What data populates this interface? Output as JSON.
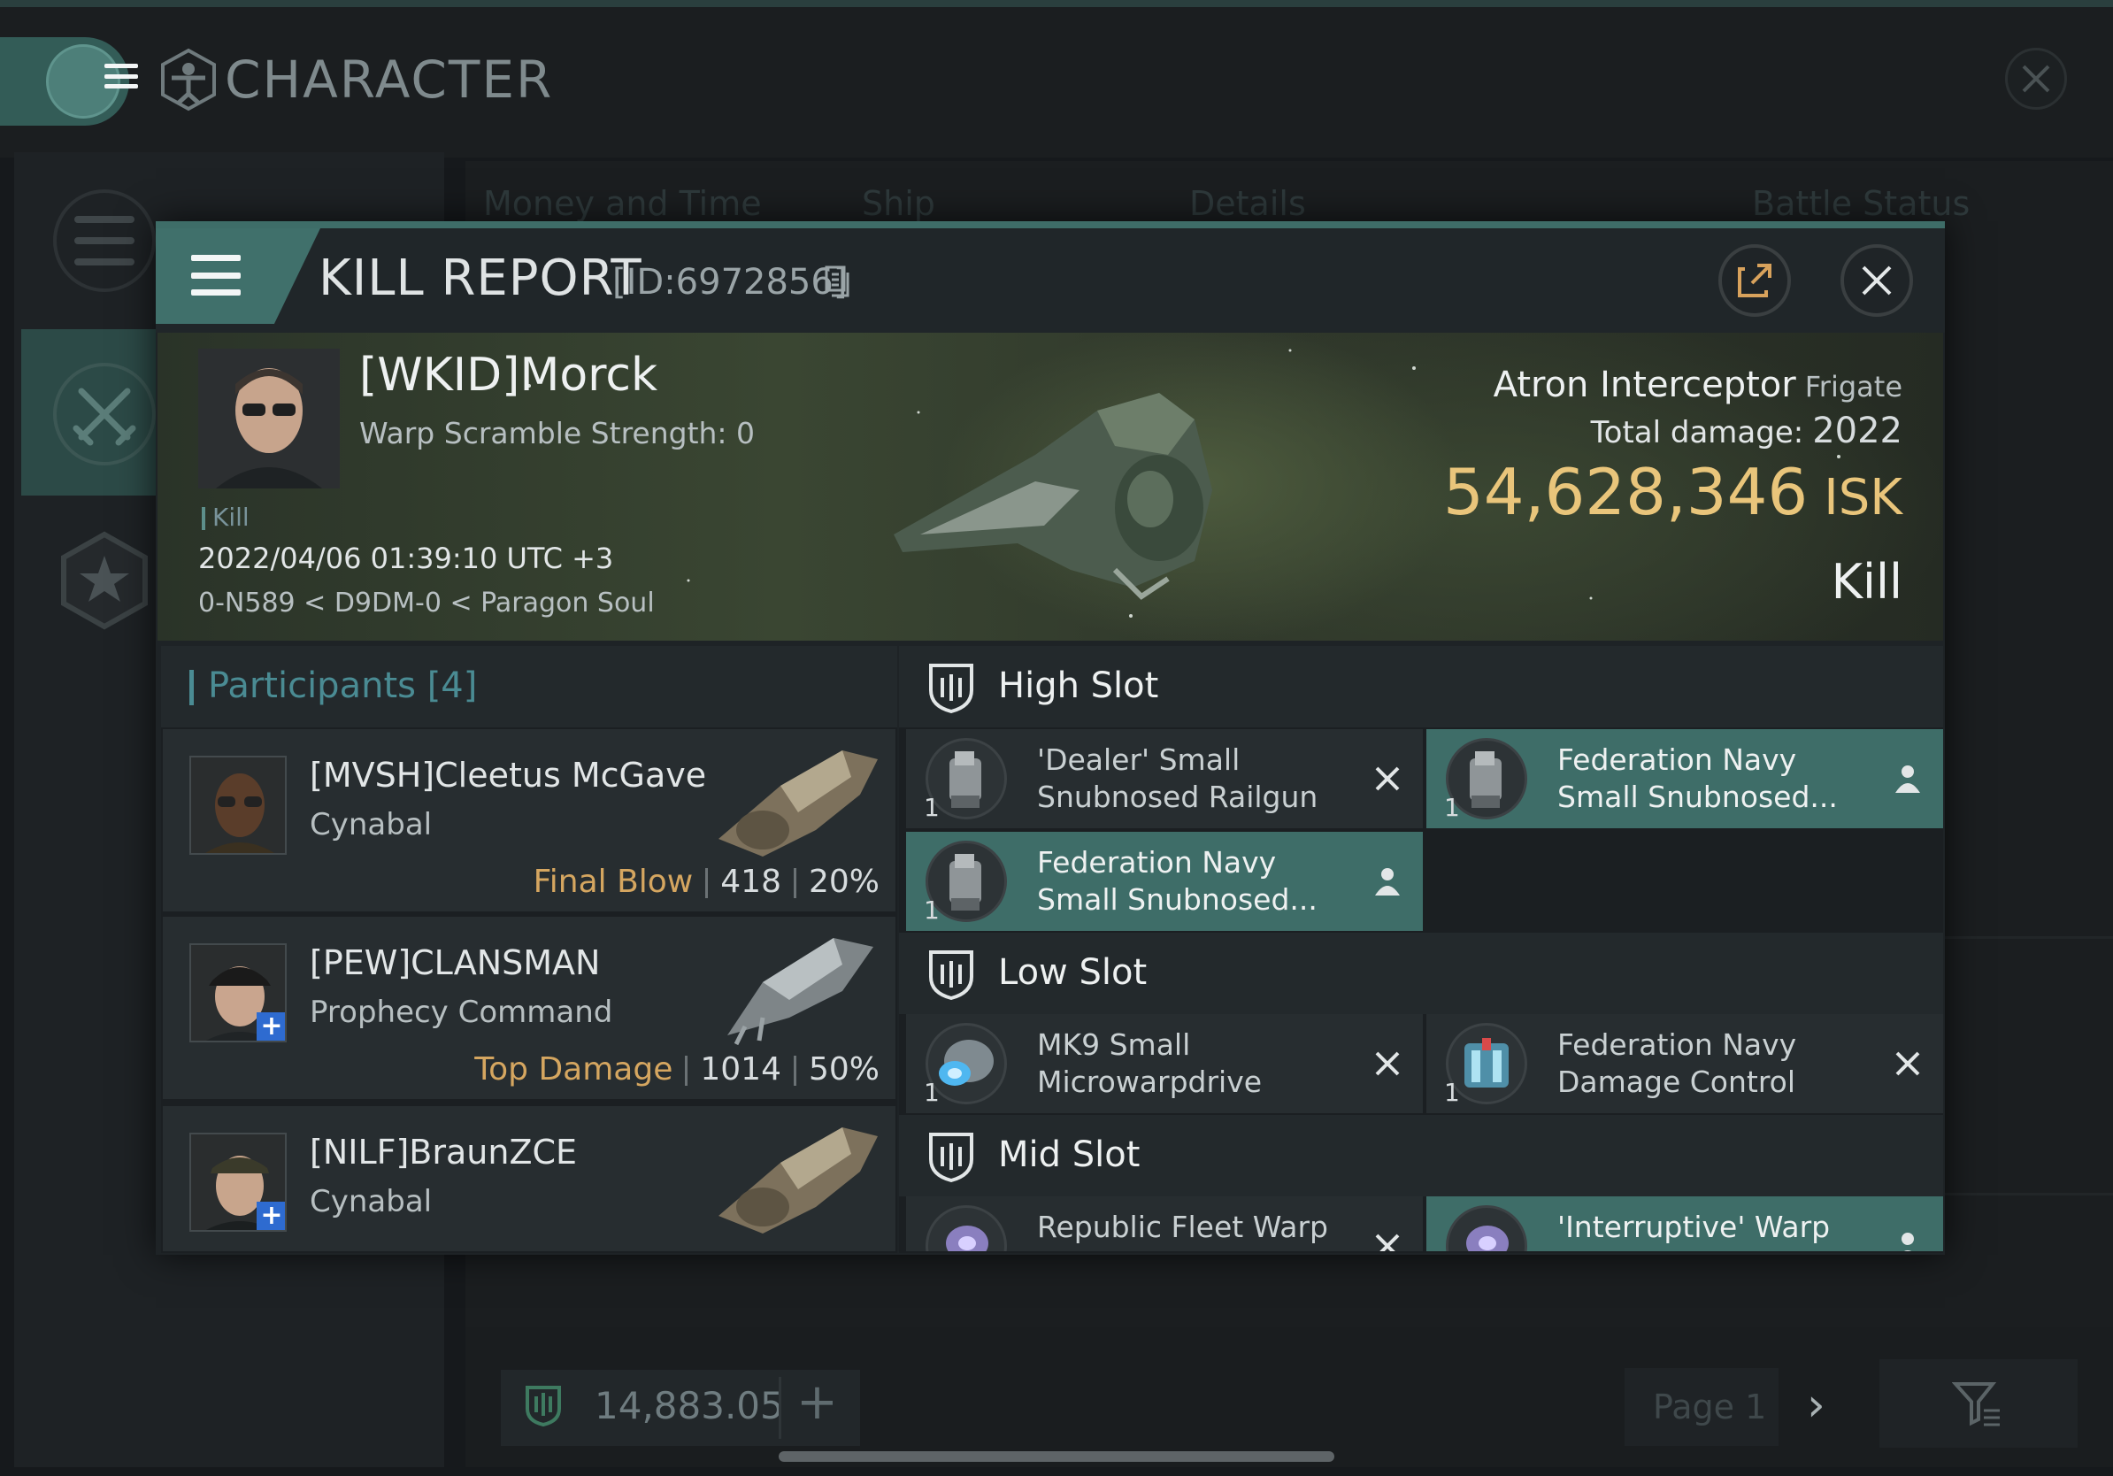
{
  "app": {
    "title": "CHARACTER",
    "background_tabs": [
      "Money and Time",
      "Ship",
      "Details",
      "Battle Status"
    ],
    "balance": "14,883.05",
    "page_label": "Page 1",
    "next_symbol": "›"
  },
  "kill_report": {
    "title": "KILL REPORT",
    "id": "[ID:6972856]",
    "victim": {
      "name": "[WKID]Morck",
      "warp_scramble": "Warp Scramble Strength: 0",
      "tag": "Kill",
      "time": "2022/04/06 01:39:10 UTC +3",
      "location": "0-N589 < D9DM-0 < Paragon Soul"
    },
    "ship": {
      "name": "Atron Interceptor",
      "class": "Frigate",
      "total_damage_label": "Total damage:",
      "total_damage": "2022",
      "isk_value": "54,628,346",
      "isk_unit": "ISK",
      "result": "Kill"
    },
    "participants": {
      "title": "Participants",
      "count": "[4]",
      "items": [
        {
          "name": "[MVSH]Cleetus McGave",
          "ship": "Cynabal",
          "tag": "Final Blow",
          "damage": "418",
          "percent": "20%"
        },
        {
          "name": "[PEW]CLANSMAN",
          "ship": "Prophecy Command",
          "tag": "Top Damage",
          "damage": "1014",
          "percent": "50%"
        },
        {
          "name": "[NILF]BraunZCE",
          "ship": "Cynabal"
        }
      ]
    },
    "slots": {
      "high": {
        "title": "High Slot",
        "modules": [
          {
            "name": "'Dealer' Small Snubnosed Railgun",
            "qty": "1",
            "status": "destroyed"
          },
          {
            "name": "Federation Navy Small Snubnosed...",
            "qty": "1",
            "status": "dropped"
          },
          {
            "name": "Federation Navy Small Snubnosed...",
            "qty": "1",
            "status": "dropped"
          }
        ]
      },
      "low": {
        "title": "Low Slot",
        "modules": [
          {
            "name": "MK9 Small Microwarpdrive",
            "qty": "1",
            "status": "destroyed"
          },
          {
            "name": "Federation Navy Damage Control",
            "qty": "1",
            "status": "destroyed"
          }
        ]
      },
      "mid": {
        "title": "Mid Slot",
        "modules": [
          {
            "name": "Republic Fleet Warp",
            "status": "destroyed"
          },
          {
            "name": "'Interruptive' Warp",
            "status": "dropped"
          }
        ]
      }
    }
  },
  "colors": {
    "accent": "#3e6d68",
    "isk_gold": "#e9c57b",
    "tag_orange": "#d5a660",
    "participants_teal": "#4a8b93",
    "plus_badge": "#2e6bd0"
  },
  "icons": [
    "hamburger-icon",
    "vitruvian-icon",
    "close-icon",
    "share-icon",
    "copy-icon",
    "star-icon",
    "crossed-swords-icon",
    "list-icon",
    "slot-shield-icon",
    "destroyed-x-icon",
    "dropped-person-icon",
    "plus-icon",
    "filter-icon",
    "chevron-right-icon"
  ]
}
